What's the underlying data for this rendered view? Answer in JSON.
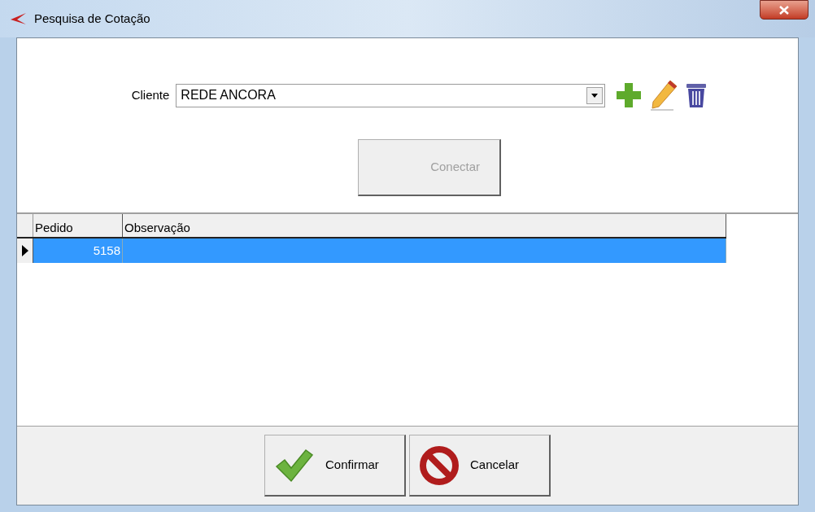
{
  "window": {
    "title": "Pesquisa de Cotação"
  },
  "client": {
    "label": "Cliente",
    "value": "REDE ANCORA"
  },
  "connect_button": {
    "label": "Conectar",
    "disabled": true
  },
  "table": {
    "columns": [
      "Pedido",
      "Observação"
    ],
    "rows": [
      {
        "cells": [
          "5158",
          ""
        ],
        "selected": true
      }
    ]
  },
  "buttons": [
    {
      "kind": "confirm",
      "label": "Confirmar"
    },
    {
      "kind": "cancel",
      "label": "Cancelar"
    }
  ]
}
